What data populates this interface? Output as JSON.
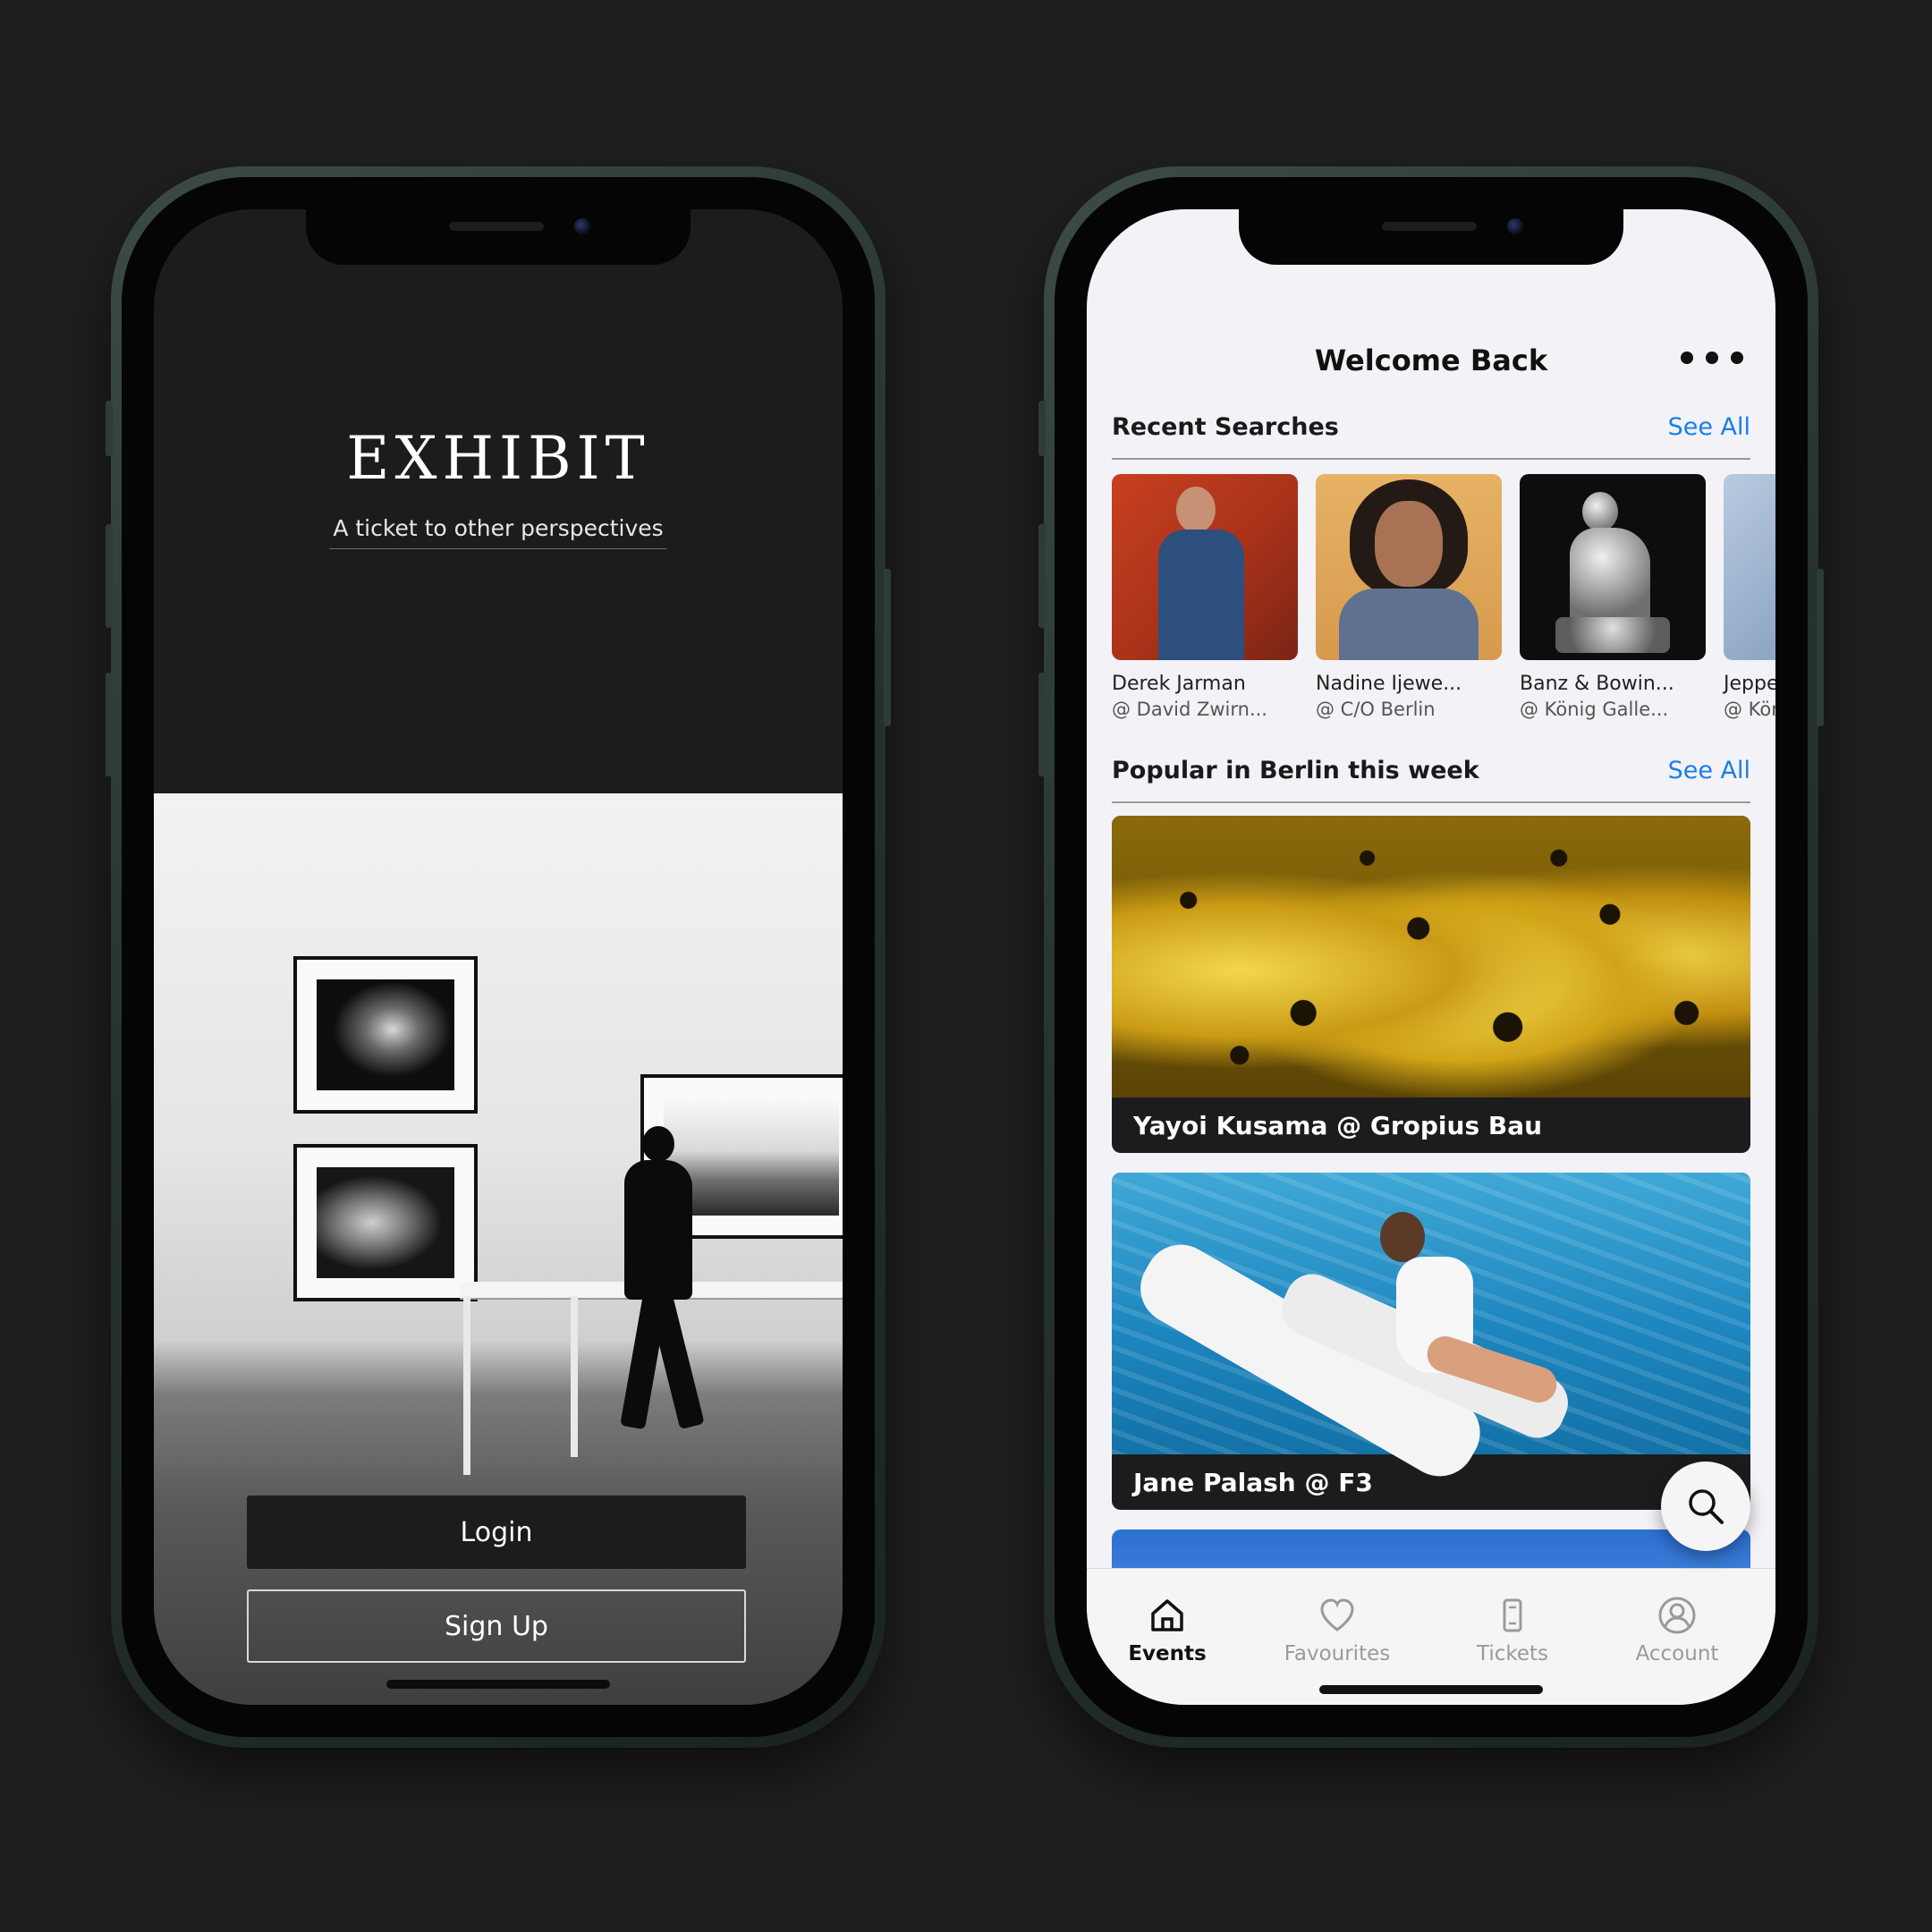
{
  "login_screen": {
    "brand": "EXHIBIT",
    "tagline": "A ticket to other perspectives",
    "login_label": "Login",
    "signup_label": "Sign Up"
  },
  "home_screen": {
    "header_title": "Welcome Back",
    "more_icon": "more-horizontal-icon",
    "recent_searches": {
      "title": "Recent Searches",
      "see_all": "See All",
      "items": [
        {
          "name": "Derek Jarman",
          "venue": "@ David Zwirn..."
        },
        {
          "name": "Nadine Ijewe...",
          "venue": "@ C/O Berlin"
        },
        {
          "name": "Banz & Bowin...",
          "venue": "@ König Galle..."
        },
        {
          "name": "Jeppe",
          "venue": "@ Kön"
        }
      ]
    },
    "popular": {
      "title": "Popular in Berlin this week",
      "see_all": "See All",
      "events": [
        {
          "caption": "Yayoi Kusama @ Gropius Bau"
        },
        {
          "caption": "Jane Palash @ F3"
        }
      ]
    },
    "search_fab_icon": "search-icon",
    "tabs": [
      {
        "label": "Events",
        "icon": "home-icon",
        "active": true
      },
      {
        "label": "Favourites",
        "icon": "heart-icon",
        "active": false
      },
      {
        "label": "Tickets",
        "icon": "ticket-icon",
        "active": false
      },
      {
        "label": "Account",
        "icon": "user-circle-icon",
        "active": false
      }
    ]
  },
  "colors": {
    "background": "#1f1f1f",
    "phone_frame": "#2e3c36",
    "link_blue": "#1a7ee6",
    "dark_surface": "#1c1c1e"
  }
}
